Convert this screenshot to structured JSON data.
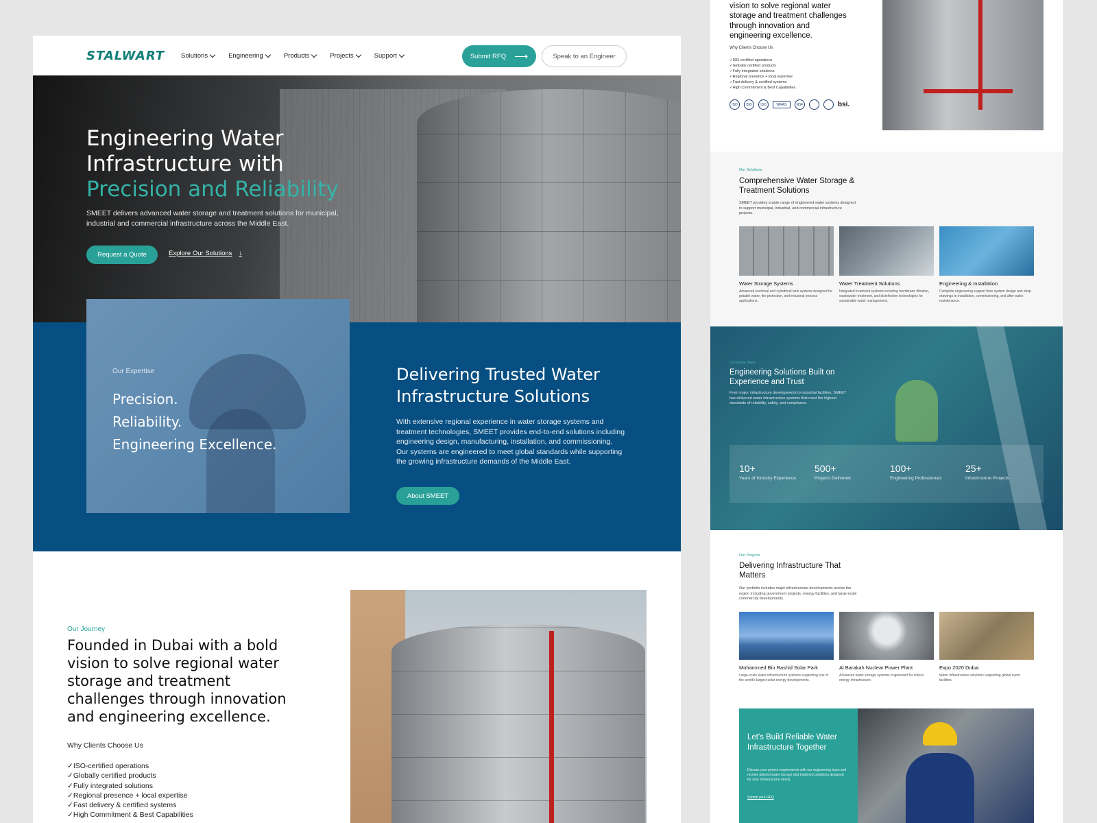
{
  "nav": {
    "logo": "STALWART",
    "links": [
      {
        "label": "Solutions"
      },
      {
        "label": "Engineering"
      },
      {
        "label": "Products"
      },
      {
        "label": "Projects"
      },
      {
        "label": "Support"
      }
    ],
    "submit_rfq": "Submit RFQ",
    "speak_engineer": "Speak to an Engineer"
  },
  "hero": {
    "title_line1": "Engineering Water",
    "title_line2": "Infrastructure with",
    "title_accent": "Precision and Reliability",
    "subtitle": "SMEET delivers advanced water storage and treatment solutions for municipal, industrial and commercial infrastructure across the Middle East.",
    "cta_quote": "Request a Quote",
    "cta_explore": "Explore Our Solutions"
  },
  "expertise": {
    "label": "Our Expertise",
    "line1": "Precision.",
    "line2": "Reliability.",
    "line3": "Engineering Excellence.",
    "title_line1": "Delivering Trusted Water",
    "title_line2": "Infrastructure Solutions",
    "body": "With extensive regional experience in water storage systems and treatment technologies, SMEET provides end-to-end solutions including engineering design, manufacturing, installation, and commissioning. Our systems are engineered to meet global standards while supporting the growing infrastructure demands of the Middle East.",
    "cta": "About SMEET"
  },
  "journey": {
    "label": "Our Journey",
    "title": "Founded in Dubai with a bold vision to solve regional water storage and treatment challenges through innovation and engineering excellence.",
    "why": "Why Clients Choose Us",
    "checks": [
      "ISO-certified operations",
      "Globally certified products",
      "Fully integrated solutions",
      "Regional presence + local expertise",
      "Fast delivery & certified systems",
      "High Commitment & Best Capabilities"
    ]
  },
  "right_intro": {
    "title": "vision to solve regional water storage and treatment challenges through innovation and engineering excellence.",
    "why": "Why Clients Choose Us",
    "checks": [
      "ISO-certified operations",
      "Globally certified products",
      "Fully integrated solutions",
      "Regional presence + local expertise",
      "Fast delivery & certified systems",
      "High Commitment & Best Capabilities"
    ],
    "certs": [
      "ISO",
      "ISO",
      "ISO",
      "WRAS",
      "NSF",
      "",
      "",
      "bsi."
    ]
  },
  "solutions": {
    "label": "Our Solutions",
    "title": "Comprehensive Water Storage & Treatment Solutions",
    "desc": "SMEET provides a wide range of engineered water systems designed to support municipal, industrial, and commercial infrastructure projects.",
    "cards": [
      {
        "name": "Water Storage Systems",
        "text": "Advanced sectional and cylindrical tank systems designed for potable water, fire protection, and industrial process applications."
      },
      {
        "name": "Water Treatment Solutions",
        "text": "Integrated treatment systems including membrane filtration, wastewater treatment, and disinfection technologies for sustainable water management."
      },
      {
        "name": "Engineering & Installation",
        "text": "Complete engineering support from system design and shop drawings to installation, commissioning, and after-sales maintenance."
      }
    ]
  },
  "stats": {
    "label": "Company Stats",
    "title": "Engineering Solutions Built on Experience and Trust",
    "desc": "From major infrastructure developments to industrial facilities, SMEET has delivered water infrastructure systems that meet the highest standards of reliability, safety, and compliance.",
    "items": [
      {
        "num": "10+",
        "label": "Years of Industry Experience"
      },
      {
        "num": "500+",
        "label": "Projects Delivered"
      },
      {
        "num": "100+",
        "label": "Engineering Professionals"
      },
      {
        "num": "25+",
        "label": "Infrastructure Projects"
      }
    ]
  },
  "projects": {
    "label": "Our Projects",
    "title": "Delivering Infrastructure That Matters",
    "desc": "Our portfolio includes major infrastructure developments across the region including government projects, energy facilities, and large-scale commercial developments.",
    "cards": [
      {
        "name": "Mohammed Bin Rashid Solar Park",
        "text": "Large-scale water infrastructure systems supporting one of the world's largest solar energy developments."
      },
      {
        "name": "Al Barakah Nuclear Power Plant",
        "text": "Advanced water storage systems engineered for critical energy infrastructure."
      },
      {
        "name": "Expo 2020 Dubai",
        "text": "Water infrastructure solutions supporting global event facilities."
      }
    ]
  },
  "cta": {
    "title": "Let's Build Reliable Water Infrastructure Together",
    "text": "Discuss your project requirements with our engineering team and receive tailored water storage and treatment solutions designed for your infrastructure needs.",
    "link": "Submit your RFQ"
  },
  "colors": {
    "teal": "#2aa198",
    "navy": "#074f82",
    "background": "#e6e6e6"
  }
}
